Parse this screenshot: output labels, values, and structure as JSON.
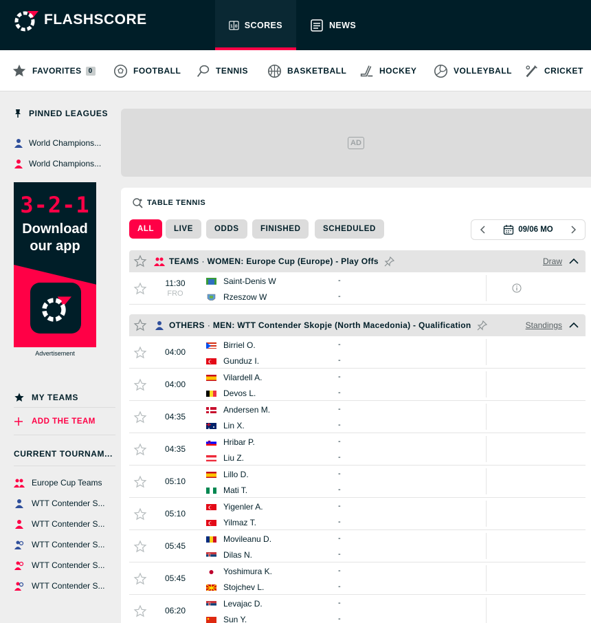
{
  "brand": {
    "name": "FLASHSCORE",
    "accent": "#ff0046",
    "dark": "#001e28"
  },
  "header": {
    "tabs": [
      {
        "label": "SCORES",
        "icon": "scores-icon",
        "active": true
      },
      {
        "label": "NEWS",
        "icon": "news-icon",
        "active": false
      }
    ]
  },
  "sports_nav": {
    "favorites": {
      "label": "FAVORITES",
      "count": "0"
    },
    "items": [
      {
        "label": "FOOTBALL",
        "icon": "football-icon"
      },
      {
        "label": "TENNIS",
        "icon": "tennis-icon"
      },
      {
        "label": "BASKETBALL",
        "icon": "basketball-icon"
      },
      {
        "label": "HOCKEY",
        "icon": "hockey-icon"
      },
      {
        "label": "VOLLEYBALL",
        "icon": "volleyball-icon"
      },
      {
        "label": "CRICKET",
        "icon": "cricket-icon"
      }
    ]
  },
  "sidebar": {
    "pinned_title": "PINNED LEAGUES",
    "pinned": [
      {
        "label": "World Champions...",
        "icon": "men-icon"
      },
      {
        "label": "World Champions...",
        "icon": "women-icon"
      }
    ],
    "promo": {
      "countdown": "3-2-1",
      "line1": "Download",
      "line2": "our app",
      "caption": "Advertisement"
    },
    "my_teams_title": "MY TEAMS",
    "add_team": "ADD THE TEAM",
    "tournaments_title": "CURRENT TOURNAM...",
    "tournaments": [
      {
        "label": "Europe Cup Teams",
        "icon": "women-teams-icon"
      },
      {
        "label": "WTT Contender S...",
        "icon": "men-icon"
      },
      {
        "label": "WTT Contender S...",
        "icon": "women-icon"
      },
      {
        "label": "WTT Contender S...",
        "icon": "men-doubles-icon"
      },
      {
        "label": "WTT Contender S...",
        "icon": "women-doubles-icon"
      },
      {
        "label": "WTT Contender S...",
        "icon": "mixed-doubles-icon"
      }
    ]
  },
  "ad": {
    "label": "AD"
  },
  "main": {
    "sport_title": "TABLE TENNIS",
    "filters": [
      "ALL",
      "LIVE",
      "ODDS",
      "FINISHED",
      "SCHEDULED"
    ],
    "active_filter": "ALL",
    "date": "09/06 MO",
    "leagues": [
      {
        "category": "TEAMS",
        "name": "WOMEN: Europe Cup (Europe) - Play Offs",
        "link": "Draw",
        "matches": [
          {
            "time": "11:30",
            "stage": "FRO",
            "home": "Saint-Denis W",
            "away": "Rzeszow W",
            "home_score": "-",
            "away_score": "-"
          }
        ]
      },
      {
        "category": "OTHERS",
        "name": "MEN: WTT Contender Skopje (North Macedonia) - Qualification",
        "link": "Standings",
        "matches": [
          {
            "time": "04:00",
            "home": "Birriel O.",
            "away": "Gunduz I.",
            "home_score": "-",
            "away_score": "-"
          },
          {
            "time": "04:00",
            "home": "Vilardell A.",
            "away": "Devos L.",
            "home_score": "-",
            "away_score": "-"
          },
          {
            "time": "04:35",
            "home": "Andersen M.",
            "away": "Lin X.",
            "home_score": "-",
            "away_score": "-"
          },
          {
            "time": "04:35",
            "home": "Hribar P.",
            "away": "Liu Z.",
            "home_score": "-",
            "away_score": "-"
          },
          {
            "time": "05:10",
            "home": "Lillo D.",
            "away": "Mati T.",
            "home_score": "-",
            "away_score": "-"
          },
          {
            "time": "05:10",
            "home": "Yigenler A.",
            "away": "Yilmaz T.",
            "home_score": "-",
            "away_score": "-"
          },
          {
            "time": "05:45",
            "home": "Movileanu D.",
            "away": "Dilas N.",
            "home_score": "-",
            "away_score": "-"
          },
          {
            "time": "05:45",
            "home": "Yoshimura K.",
            "away": "Stojchev L.",
            "home_score": "-",
            "away_score": "-"
          },
          {
            "time": "06:20",
            "home": "Levajac D.",
            "away": "Sun Y.",
            "home_score": "-",
            "away_score": "-"
          }
        ]
      }
    ]
  }
}
